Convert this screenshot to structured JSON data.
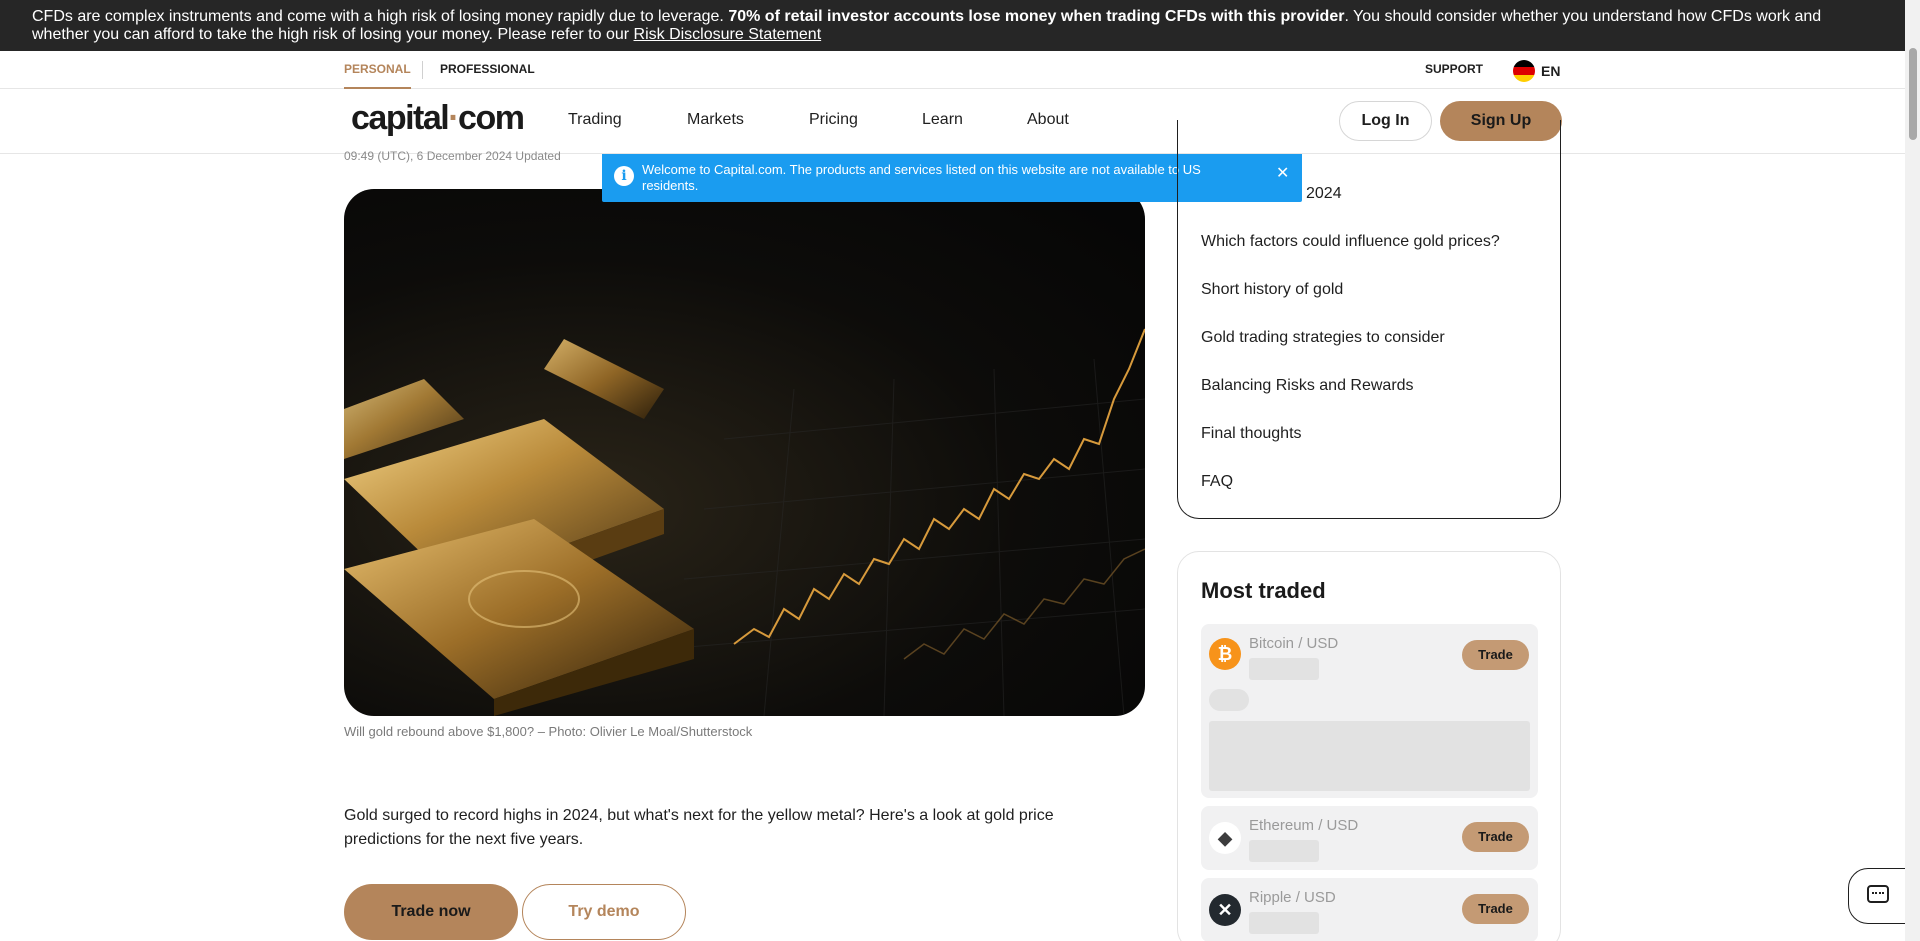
{
  "risk_banner": {
    "text_before": "CFDs are complex instruments and come with a high risk of losing money rapidly due to leverage. ",
    "text_bold": "70% of retail investor accounts lose money when trading CFDs with this provider",
    "text_after": ". You should consider whether you understand how CFDs work and whether you can afford to take the high risk of losing your money. Please refer to our ",
    "link_text": "Risk Disclosure Statement"
  },
  "subnav": {
    "personal": "PERSONAL",
    "professional": "PROFESSIONAL",
    "support": "SUPPORT",
    "language": "EN"
  },
  "header": {
    "logo_left": "capital",
    "logo_dot": "·",
    "logo_right": "com",
    "nav": [
      "Trading",
      "Markets",
      "Pricing",
      "Learn",
      "About"
    ],
    "login": "Log In",
    "signup": "Sign Up"
  },
  "article": {
    "timestamp": "09:49 (UTC), 6 December 2024 Updated",
    "caption": "Will gold rebound above $1,800? – Photo: Olivier Le Moal/Shutterstock",
    "intro": "Gold surged to record highs in 2024, but what's next for the yellow metal? Here's a look at gold price predictions for the next five years.",
    "trade_now": "Trade now",
    "try_demo": "Try demo"
  },
  "notice": {
    "text": "Welcome to Capital.com. The products and services listed on this website are not available to US residents.",
    "close": "✕"
  },
  "toc": {
    "items": [
      "2024",
      "Which factors could influence gold prices?",
      "Short history of gold",
      "Gold trading strategies to consider",
      "Balancing Risks and Rewards",
      "Final thoughts",
      "FAQ"
    ]
  },
  "most_traded": {
    "title": "Most traded",
    "items": [
      {
        "pair": "Bitcoin / USD",
        "trade": "Trade",
        "icon": "bitcoin-icon",
        "color": "#f7931a"
      },
      {
        "pair": "Ethereum / USD",
        "trade": "Trade",
        "icon": "ethereum-icon",
        "color": "#ffffff"
      },
      {
        "pair": "Ripple / USD",
        "trade": "Trade",
        "icon": "ripple-icon",
        "color": "#23292f"
      }
    ]
  },
  "colors": {
    "accent": "#b4855b",
    "notice_bg": "#1a9cf0",
    "banner_bg": "#262626"
  }
}
